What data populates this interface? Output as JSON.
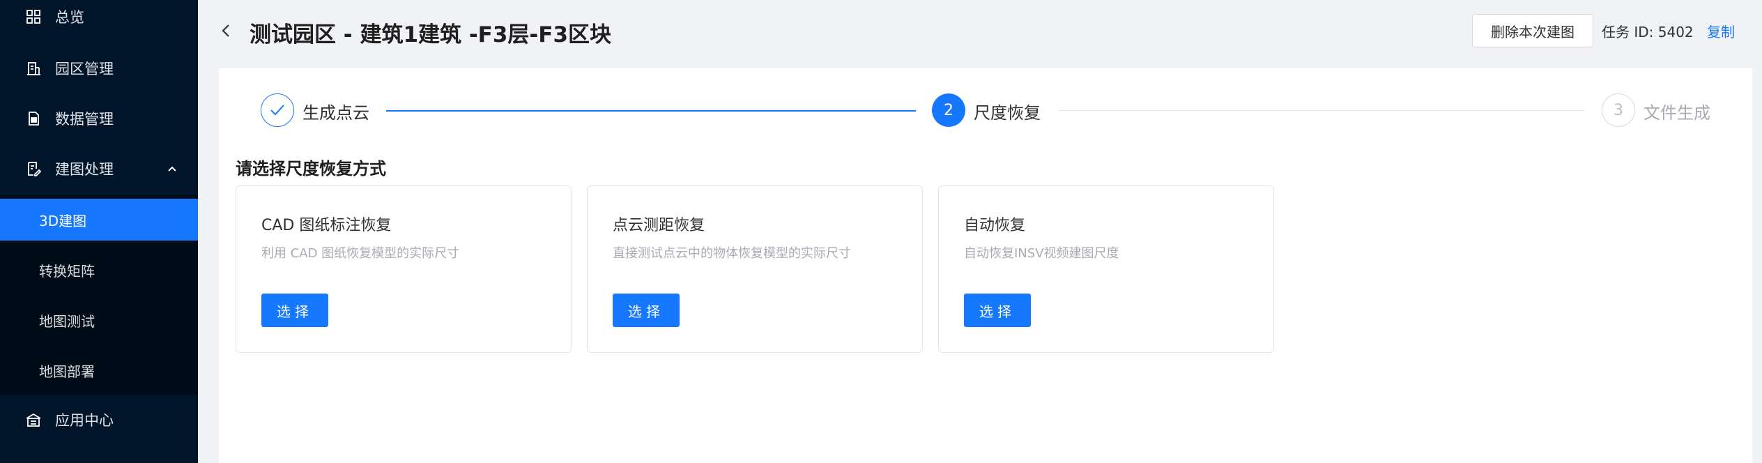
{
  "sidebar": {
    "items": [
      {
        "label": "总览",
        "icon": "dashboard-icon"
      },
      {
        "label": "园区管理",
        "icon": "building-icon"
      },
      {
        "label": "数据管理",
        "icon": "file-icon"
      },
      {
        "label": "建图处理",
        "icon": "map-edit-icon",
        "expanded": true
      }
    ],
    "submenu": [
      {
        "label": "3D建图",
        "active": true
      },
      {
        "label": "转换矩阵",
        "active": false
      },
      {
        "label": "地图测试",
        "active": false
      },
      {
        "label": "地图部署",
        "active": false
      }
    ],
    "bottom_item": {
      "label": "应用中心",
      "icon": "app-center-icon"
    }
  },
  "header": {
    "title": "测试园区 - 建筑1建筑 -F3层-F3区块",
    "delete_button": "删除本次建图",
    "task_id": "任务 ID: 5402",
    "copy_link": "复制"
  },
  "steps": [
    {
      "number": "1",
      "label": "生成点云",
      "status": "done"
    },
    {
      "number": "2",
      "label": "尺度恢复",
      "status": "current"
    },
    {
      "number": "3",
      "label": "文件生成",
      "status": "wait"
    }
  ],
  "section_title": "请选择尺度恢复方式",
  "cards": [
    {
      "title": "CAD 图纸标注恢复",
      "description": "利用 CAD 图纸恢复模型的实际尺寸",
      "button": "选择"
    },
    {
      "title": "点云测距恢复",
      "description": "直接测试点云中的物体恢复模型的实际尺寸",
      "button": "选择"
    },
    {
      "title": "自动恢复",
      "description": "自动恢复INSV视频建图尺度",
      "button": "选择"
    }
  ],
  "colors": {
    "sidebar_bg": "#001529",
    "submenu_bg": "#000c17",
    "accent": "#1677ff",
    "page_bg": "#f0f2f5"
  }
}
